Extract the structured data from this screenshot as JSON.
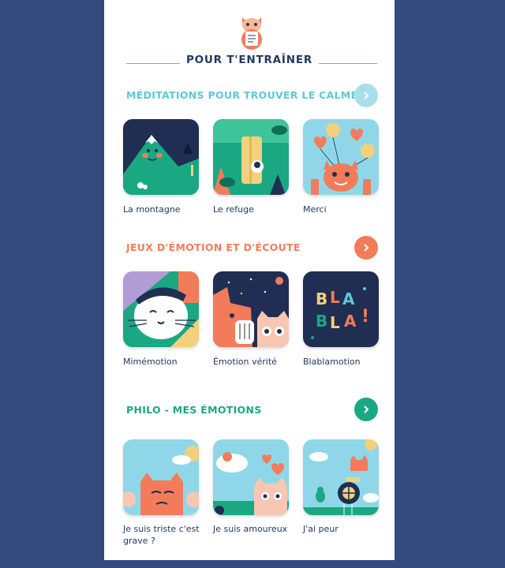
{
  "header": {
    "title": "POUR T'ENTRAÎNER"
  },
  "sections": [
    {
      "title": "MÉDITATIONS POUR TROUVER LE CALME",
      "color": "#5fc8d5",
      "arrow_color": "#a9dfe9",
      "items": [
        {
          "label": "La montagne",
          "icon": "mountain-illustration"
        },
        {
          "label": "Le refuge",
          "icon": "refuge-illustration"
        },
        {
          "label": "Merci",
          "icon": "cat-balloons-illustration"
        }
      ]
    },
    {
      "title": "JEUX D'ÉMOTION ET D'ÉCOUTE",
      "color": "#f27c5a",
      "arrow_color": "#f27c5a",
      "items": [
        {
          "label": "Mimémotion",
          "icon": "white-cat-illustration"
        },
        {
          "label": "Émotion vérité",
          "icon": "cats-night-illustration"
        },
        {
          "label": "Blablamotion",
          "icon": "blabla-illustration"
        }
      ]
    },
    {
      "title": "PHILO - MES ÉMOTIONS",
      "color": "#1aa882",
      "arrow_color": "#1aa882",
      "items": [
        {
          "label": "Je suis triste c'est grave ?",
          "icon": "sad-cat-illustration"
        },
        {
          "label": "Je suis amoureux",
          "icon": "love-cat-illustration"
        },
        {
          "label": "J'ai peur",
          "icon": "fear-illustration"
        }
      ]
    }
  ]
}
